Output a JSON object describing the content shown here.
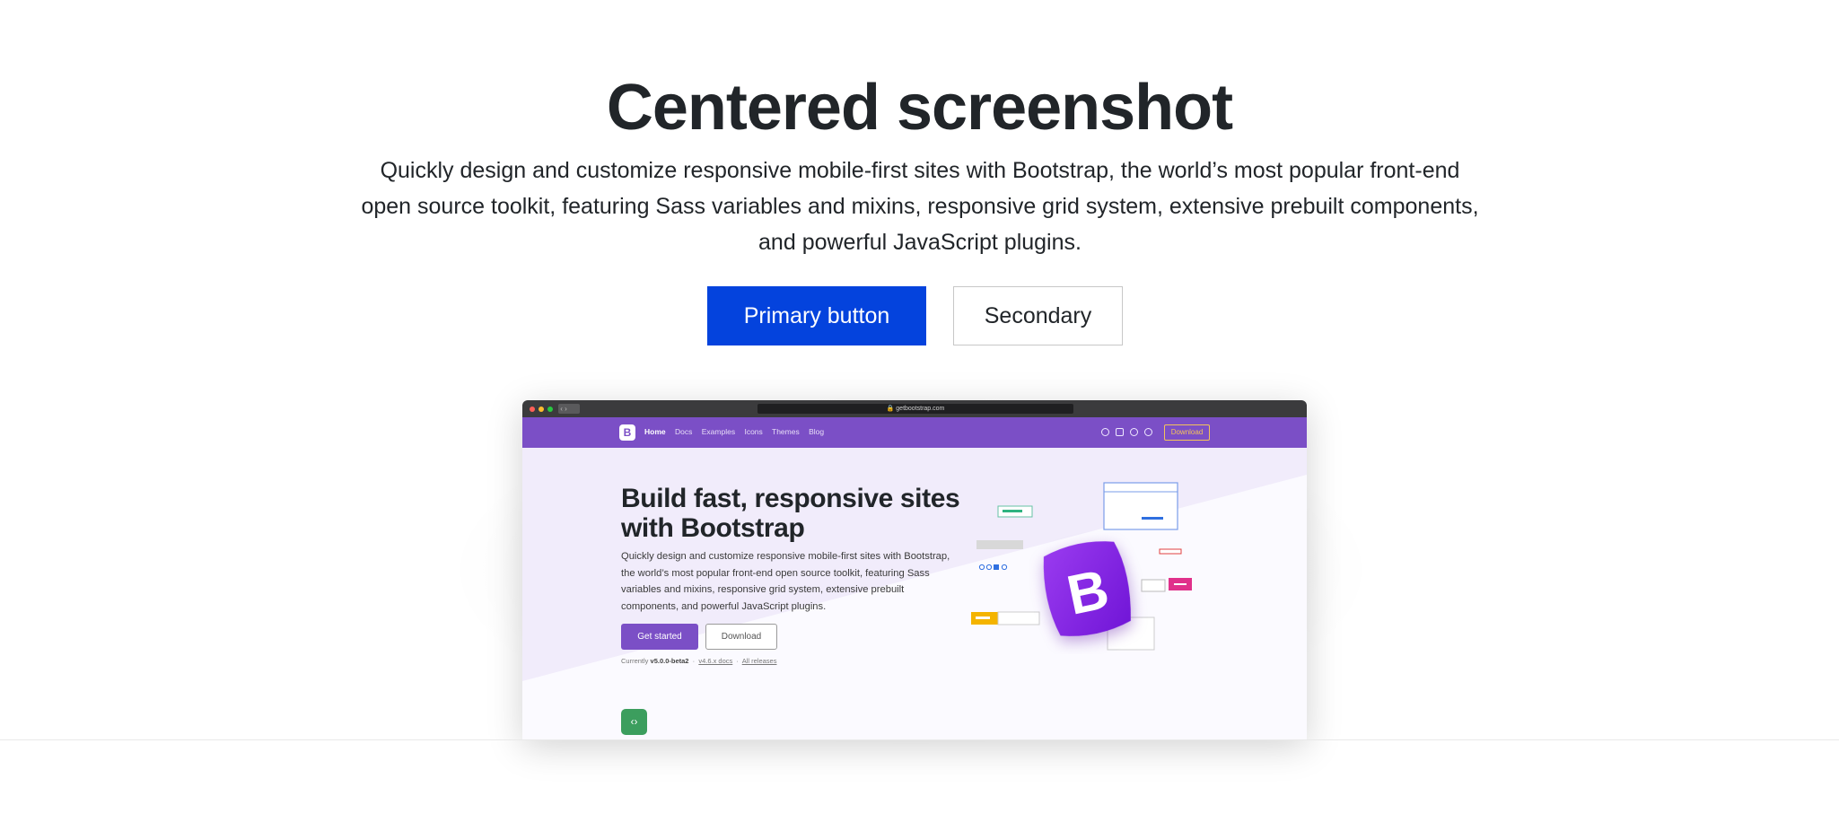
{
  "hero": {
    "title": "Centered screenshot",
    "lead": "Quickly design and customize responsive mobile-first sites with Bootstrap, the world’s most popular front-end open source toolkit, featuring Sass variables and mixins, responsive grid system, extensive prebuilt components, and powerful JavaScript plugins.",
    "primary_label": "Primary button",
    "secondary_label": "Secondary"
  },
  "colors": {
    "primary": "#0443dd",
    "bootstrap_purple": "#7b4fc6",
    "download_yellow": "#f4c35a",
    "code_green": "#3c9e5e"
  },
  "screenshot": {
    "url": "getbootstrap.com",
    "nav": {
      "logo": "B",
      "links": [
        "Home",
        "Docs",
        "Examples",
        "Icons",
        "Themes",
        "Blog"
      ],
      "active": "Home",
      "icons": [
        "github-icon",
        "twitter-icon",
        "slack-icon",
        "opencollective-icon"
      ],
      "download_label": "Download"
    },
    "heading": "Build fast, responsive sites with Bootstrap",
    "lead": "Quickly design and customize responsive mobile-first sites with Bootstrap, the world’s most popular front-end open source toolkit, featuring Sass variables and mixins, responsive grid system, extensive prebuilt components, and powerful JavaScript plugins.",
    "get_started_label": "Get started",
    "download_label": "Download",
    "currently_prefix": "Currently",
    "version": "v5.0.0-beta2",
    "v4_docs": "v4.6.x docs",
    "all_releases": "All releases",
    "code_icon": "‹›",
    "big_logo": "B"
  }
}
